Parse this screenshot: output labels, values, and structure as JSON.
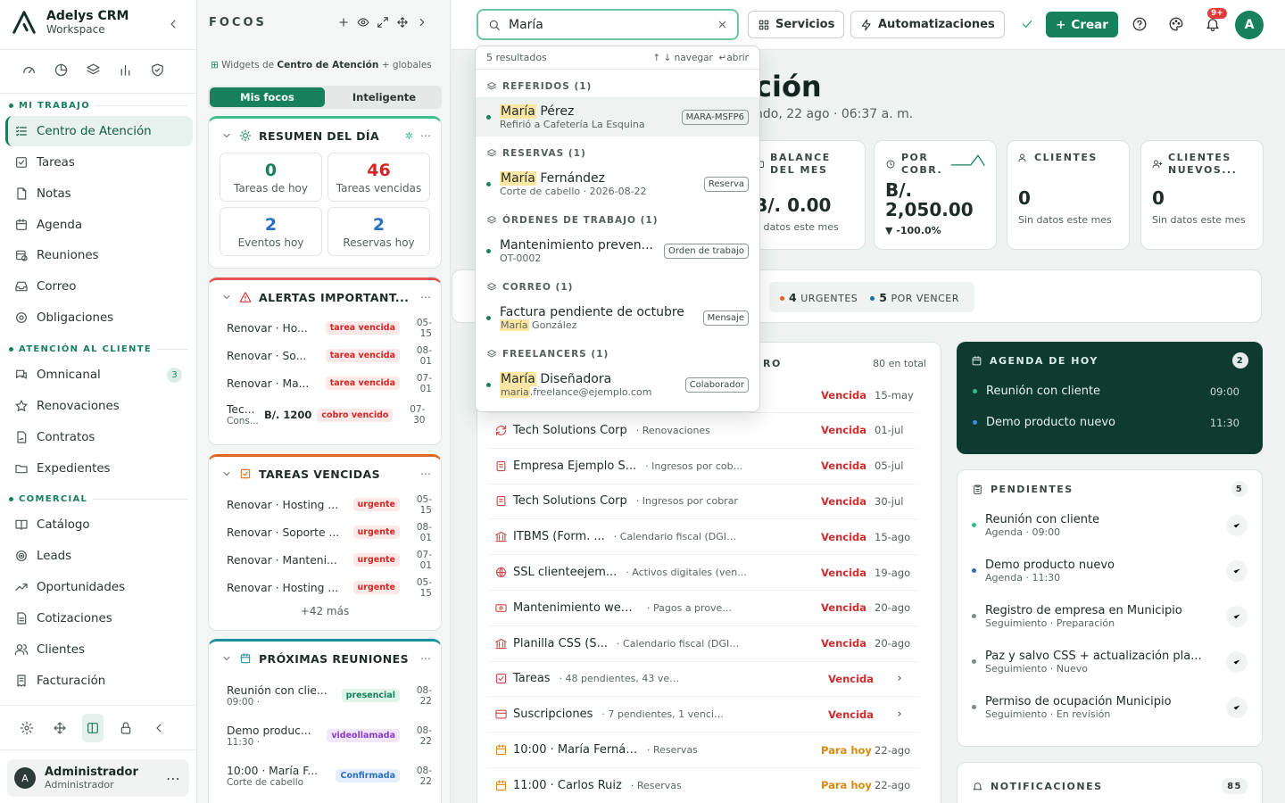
{
  "brand": {
    "name": "Adelys CRM",
    "sub": "Workspace"
  },
  "sidebar": {
    "sections": {
      "work": "MI TRABAJO",
      "client": "ATENCIÓN AL CLIENTE",
      "commercial": "COMERCIAL"
    },
    "work_items": [
      "Centro de Atención",
      "Tareas",
      "Notas",
      "Agenda",
      "Reuniones",
      "Correo",
      "Obligaciones"
    ],
    "client_items": [
      "Omnicanal",
      "Renovaciones",
      "Contratos",
      "Expedientes"
    ],
    "omnicanal_count": "3",
    "commercial_items": [
      "Catálogo",
      "Leads",
      "Oportunidades",
      "Cotizaciones",
      "Clientes",
      "Facturación"
    ],
    "user": {
      "initial": "A",
      "name": "Administrador",
      "role": "Administrador"
    }
  },
  "focus": {
    "title": "FOCOS",
    "sub_prefix": "Widgets de",
    "sub_bold": "Centro de Atención",
    "sub_suffix": "+ globales",
    "tabs": [
      "Mis focos",
      "Inteligente"
    ],
    "summary": {
      "title": "RESUMEN DEL DÍA",
      "stats": [
        {
          "value": "0",
          "label": "Tareas de hoy",
          "color": "#17805d"
        },
        {
          "value": "46",
          "label": "Tareas vencidas",
          "color": "#d32727"
        },
        {
          "value": "2",
          "label": "Eventos hoy",
          "color": "#2a6fc1"
        },
        {
          "value": "2",
          "label": "Reservas hoy",
          "color": "#2a6fc1"
        }
      ]
    },
    "alerts": {
      "title": "ALERTAS IMPORTANT...",
      "rows": [
        {
          "name": "Renovar · Ho...",
          "badge": "tarea vencida",
          "date": "05-15"
        },
        {
          "name": "Renovar · So...",
          "badge": "tarea vencida",
          "date": "08-01"
        },
        {
          "name": "Renovar · Ma...",
          "badge": "tarea vencida",
          "date": "07-01"
        }
      ],
      "last": {
        "name": "Tec...",
        "sub": "Cons...",
        "amount": "B/. 1200",
        "badge": "cobro vencido",
        "date": "07-30"
      }
    },
    "overdue": {
      "title": "TAREAS VENCIDAS",
      "rows": [
        {
          "name": "Renovar · Hosting ...",
          "badge": "urgente",
          "date": "05-15"
        },
        {
          "name": "Renovar · Soporte ...",
          "badge": "urgente",
          "date": "08-01"
        },
        {
          "name": "Renovar · Manteni...",
          "badge": "urgente",
          "date": "07-01"
        },
        {
          "name": "Renovar · Hosting ...",
          "badge": "urgente",
          "date": "05-15"
        }
      ],
      "more": "+42 más"
    },
    "meetings": {
      "title": "PRÓXIMAS REUNIONES",
      "rows": [
        {
          "name": "Reunión con clie...",
          "sub": "09:00 ·",
          "badge": "presencial",
          "date": "08-22"
        },
        {
          "name": "Demo produc...",
          "sub": "11:30 ·",
          "badge": "videollamada",
          "date": "08-22"
        },
        {
          "name": "10:00 · María F...",
          "sub": "Corte de cabello",
          "badge": "Confirmada",
          "date": "08-22"
        }
      ]
    }
  },
  "topbar": {
    "search_value": "María",
    "servicios": "Servicios",
    "automatizaciones": "Automatizaciones",
    "crear": "Crear",
    "notif_badge": "9+",
    "avatar": "A"
  },
  "main": {
    "title": "ción",
    "subtitle": "ndo, 22 ago · 06:37 a. m.",
    "kpis": [
      {
        "label": "BALANCE DEL MES",
        "value": "B/. 0.00",
        "sub": "n datos este mes"
      },
      {
        "label": "POR COBR.",
        "value": "B/. 2,050.00",
        "sub": "▼ -100.0%"
      },
      {
        "label": "CLIENTES",
        "value": "0",
        "sub": "Sin datos este mes"
      },
      {
        "label": "CLIENTES NUEVOS...",
        "value": "0",
        "sub": "Sin datos este mes"
      }
    ],
    "chips": {
      "urgent_count": "4",
      "urgent_label": "URGENTES",
      "due_count": "5",
      "due_label": "POR VENCER"
    },
    "list": {
      "title": "RO",
      "total": "80 en total",
      "rows": [
        {
          "name": "",
          "cat": "",
          "status": "Vencida",
          "date": "15-may",
          "icon": "",
          "today": false,
          "chev": false
        },
        {
          "name": "Tech Solutions Corp",
          "cat": "· Renovaciones",
          "status": "Vencida",
          "date": "01-jul",
          "icon": "refresh",
          "today": false,
          "chev": false
        },
        {
          "name": "Empresa Ejemplo S...",
          "cat": "· Ingresos por cob...",
          "status": "Vencida",
          "date": "05-jul",
          "icon": "invoice",
          "today": false,
          "chev": false
        },
        {
          "name": "Tech Solutions Corp",
          "cat": "· Ingresos por cobrar",
          "status": "Vencida",
          "date": "30-jul",
          "icon": "invoice",
          "today": false,
          "chev": false
        },
        {
          "name": "ITBMS (Form. ...",
          "cat": "· Calendario fiscal (DGI /...",
          "status": "Vencida",
          "date": "15-ago",
          "icon": "bank",
          "today": false,
          "chev": false
        },
        {
          "name": "SSL clienteejem...",
          "cat": "· Activos digitales (ven...",
          "status": "Vencida",
          "date": "19-ago",
          "icon": "globe",
          "today": false,
          "chev": false
        },
        {
          "name": "Mantenimiento web ...",
          "cat": "· Pagos a prove...",
          "status": "Vencida",
          "date": "20-ago",
          "icon": "money",
          "today": false,
          "chev": false
        },
        {
          "name": "Planilla CSS (S...",
          "cat": "· Calendario fiscal (DGI /...",
          "status": "Vencida",
          "date": "20-ago",
          "icon": "bank",
          "today": false,
          "chev": false
        },
        {
          "name": "Tareas",
          "cat": "· 48 pendientes, 43 vencidas",
          "status": "Vencida",
          "date": "",
          "icon": "check",
          "today": false,
          "chev": true
        },
        {
          "name": "Suscripciones",
          "cat": "· 7 pendientes, 1 vencidas",
          "status": "Vencida",
          "date": "",
          "icon": "card",
          "today": false,
          "chev": true
        },
        {
          "name": "10:00 · María Fernández",
          "cat": "· Reservas",
          "status": "Para hoy",
          "date": "22-ago",
          "icon": "calendar",
          "today": true,
          "chev": false
        },
        {
          "name": "11:00 · Carlos Ruiz",
          "cat": "· Reservas",
          "status": "Para hoy",
          "date": "22-ago",
          "icon": "calendar",
          "today": true,
          "chev": false
        }
      ]
    },
    "agenda": {
      "title": "AGENDA DE HOY",
      "count": "2",
      "rows": [
        {
          "name": "Reunión con cliente",
          "time": "09:00",
          "color": "#2fbf82"
        },
        {
          "name": "Demo producto nuevo",
          "time": "11:30",
          "color": "#3a8fe0"
        }
      ]
    },
    "pending": {
      "title": "PENDIENTES",
      "count": "5",
      "rows": [
        {
          "name": "Reunión con cliente",
          "sub": "Agenda · 09:00",
          "color": "#2fbf82"
        },
        {
          "name": "Demo producto nuevo",
          "sub": "Agenda · 11:30",
          "color": "#2a6fc1"
        },
        {
          "name": "Registro de empresa en Municipio",
          "sub": "Seguimiento · Preparación",
          "color": "#7c8a86"
        },
        {
          "name": "Paz y salvo CSS + actualización pla...",
          "sub": "Seguimiento · Nuevo",
          "color": "#7c8a86"
        },
        {
          "name": "Permiso de ocupación Municipio",
          "sub": "Seguimiento · En revisión",
          "color": "#7c8a86"
        }
      ]
    },
    "notifications": {
      "title": "NOTIFICACIONES",
      "count": "85"
    }
  },
  "dropdown": {
    "count": "5 resultados",
    "nav_hint": "↑ ↓ navegar",
    "open_hint": "↵abrir",
    "sections": [
      {
        "label": "REFERIDOS (1)",
        "items": [
          {
            "hl": "María",
            "rest": " Pérez",
            "sub": "Refirió a Cafetería La Esquina",
            "sub_hl": "",
            "tag": "MARA-MSFP6",
            "selected": true
          }
        ]
      },
      {
        "label": "RESERVAS (1)",
        "items": [
          {
            "hl": "María",
            "rest": " Fernández",
            "sub": "Corte de cabello · 2026-08-22",
            "sub_hl": "",
            "tag": "Reserva",
            "selected": false
          }
        ]
      },
      {
        "label": "ÓRDENES DE TRABAJO (1)",
        "items": [
          {
            "hl": "",
            "rest": "Mantenimiento preven...",
            "sub": "OT-0002",
            "sub_hl": "",
            "tag": "Orden de trabajo",
            "selected": false
          }
        ]
      },
      {
        "label": "CORREO (1)",
        "items": [
          {
            "hl": "",
            "rest": "Factura pendiente de octubre",
            "sub": " González",
            "sub_hl": "María",
            "tag": "Mensaje",
            "selected": false
          }
        ]
      },
      {
        "label": "FREELANCERS (1)",
        "items": [
          {
            "hl": "María",
            "rest": " Diseñadora",
            "sub": ".freelance@ejemplo.com",
            "sub_hl": "maria",
            "tag": "Colaborador",
            "selected": false
          }
        ]
      }
    ]
  }
}
